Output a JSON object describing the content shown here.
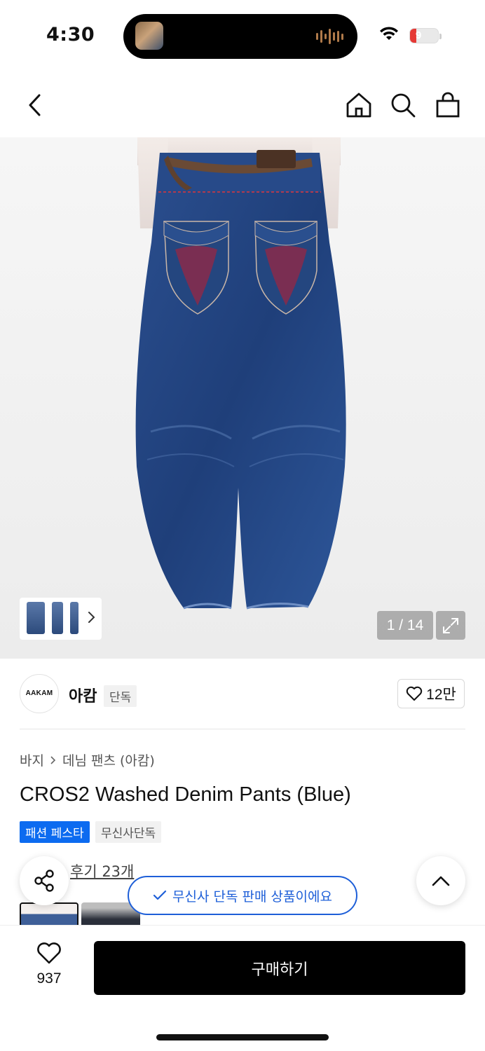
{
  "status_bar": {
    "time": "4:30",
    "battery": "9"
  },
  "product_image": {
    "counter": "1 / 14"
  },
  "brand": {
    "logo_text": "AAKAM",
    "name": "아캄",
    "badge": "단독",
    "likes": "12만"
  },
  "breadcrumb": {
    "category": "바지",
    "subcategory": "데님 팬츠 (아캄)"
  },
  "product": {
    "title": "CROS2 Washed Denim Pants (Blue)",
    "tags": [
      "패션 페스타",
      "무신사단독"
    ]
  },
  "reviews": {
    "label": "후기 23개"
  },
  "toast": {
    "message": "무신사 단독 판매 상품이에요"
  },
  "bottom_bar": {
    "wish_count": "937",
    "buy_label": "구매하기"
  },
  "colors": {
    "accent_blue": "#0c6bf0",
    "toast_blue": "#1e5fd8",
    "buy_button": "#000000"
  },
  "icons": [
    "back-icon",
    "home-icon",
    "search-icon",
    "bag-icon",
    "chevron-right-icon",
    "expand-icon",
    "heart-icon",
    "share-icon",
    "chevron-up-icon",
    "check-icon"
  ]
}
